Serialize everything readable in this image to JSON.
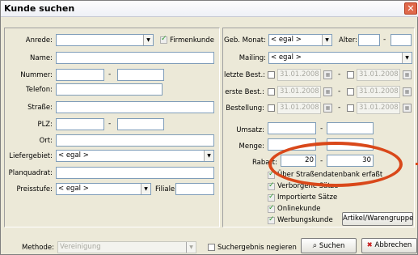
{
  "window": {
    "title": "Kunde suchen",
    "close_glyph": "✕"
  },
  "left": {
    "anrede_label": "Anrede:",
    "firmenkunde_label": "Firmenkunde",
    "name_label": "Name:",
    "nummer_label": "Nummer:",
    "telefon_label": "Telefon:",
    "strasse_label": "Straße:",
    "plz_label": "PLZ:",
    "ort_label": "Ort:",
    "liefergebiet_label": "Liefergebiet:",
    "liefergebiet_value": "< egal >",
    "planquadrat_label": "Planquadrat:",
    "preisstufe_label": "Preisstufe:",
    "preisstufe_value": "< egal >",
    "filiale_label": "Filiale:",
    "dash": "-"
  },
  "right": {
    "geb_monat_label": "Geb. Monat:",
    "geb_monat_value": "< egal >",
    "alter_label": "Alter:",
    "mailing_label": "Mailing:",
    "mailing_value": "< egal >",
    "letzte_best_label": "letzte Best.:",
    "erste_best_label": "erste Best.:",
    "bestellung_label": "Bestellung:",
    "date_value": "31.01.2008",
    "umsatz_label": "Umsatz:",
    "menge_label": "Menge:",
    "rabatt_label": "Rabatt:",
    "rabatt_from": "20",
    "rabatt_to": "30",
    "checks": [
      {
        "label": "Über Straßendatenbank erfaßt"
      },
      {
        "label": "Verborgene Sätze"
      },
      {
        "label": "Importierte Sätze"
      },
      {
        "label": "Onlinekunde"
      },
      {
        "label": "Werbungskunde"
      }
    ],
    "artikel_button": "Artikel/Warengruppe",
    "dash": "-"
  },
  "bottom": {
    "methode_label": "Methode:",
    "methode_value": "Vereinigung",
    "negieren_label": "Suchergebnis negieren",
    "suchen_button": "Suchen",
    "abbrechen_button": "Abbrechen"
  },
  "colors": {
    "annotation": "#d9481a",
    "title_bg": "#f5f6fa"
  }
}
